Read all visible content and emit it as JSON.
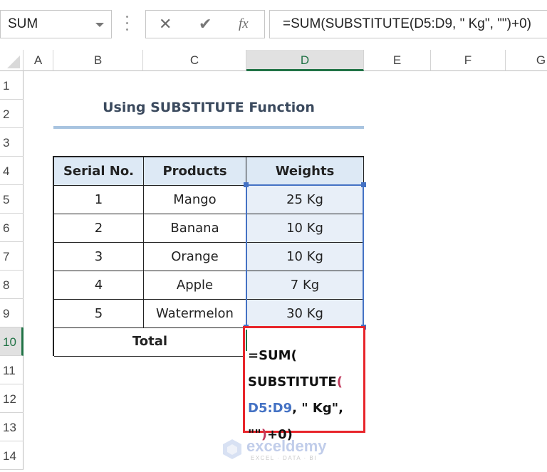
{
  "formula_bar": {
    "name_box": "SUM",
    "cancel_icon": "✕",
    "enter_icon": "✔",
    "fx_label": "fx",
    "formula": "=SUM(SUBSTITUTE(D5:D9, \" Kg\", \"\")+0)"
  },
  "columns": [
    "A",
    "B",
    "C",
    "D",
    "E",
    "F",
    "G"
  ],
  "selected_column": "D",
  "rows": [
    "1",
    "2",
    "3",
    "4",
    "5",
    "6",
    "7",
    "8",
    "9",
    "10",
    "11",
    "12",
    "13",
    "14"
  ],
  "selected_row": "10",
  "sheet": {
    "title": "Using SUBSTITUTE Function",
    "headers": [
      "Serial No.",
      "Products",
      "Weights"
    ],
    "data": [
      {
        "serial": "1",
        "product": "Mango",
        "weight": "25 Kg"
      },
      {
        "serial": "2",
        "product": "Banana",
        "weight": "10 Kg"
      },
      {
        "serial": "3",
        "product": "Orange",
        "weight": "10 Kg"
      },
      {
        "serial": "4",
        "product": "Apple",
        "weight": "7 Kg"
      },
      {
        "serial": "5",
        "product": "Watermelon",
        "weight": "30 Kg"
      }
    ],
    "total_label": "Total",
    "edit_formula_lines": {
      "l1": "=SUM(",
      "l2a": "SUBSTITUTE",
      "l2b": "(",
      "l3a": "D5:D9",
      "l3b": ", \" Kg\",",
      "l4a": "\"\"",
      "l4b": ")",
      "l4c": "+0)"
    }
  },
  "watermark": {
    "name": "exceldemy",
    "tagline": "EXCEL · DATA · BI"
  },
  "colors": {
    "accent_green": "#217346",
    "selection_blue": "#4472c4",
    "highlight_red": "#e8252b",
    "header_fill": "#dde9f5"
  }
}
